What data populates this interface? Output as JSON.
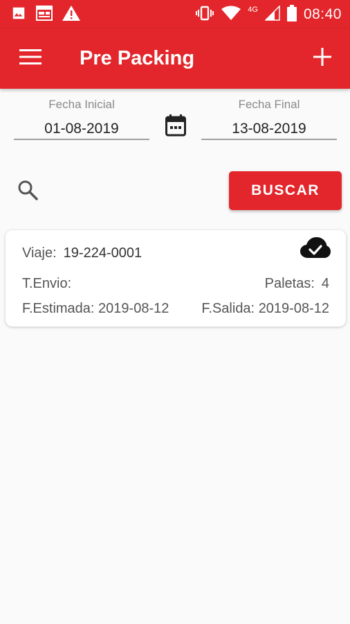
{
  "status_bar": {
    "time": "08:40",
    "network": "4G",
    "icons": [
      "image-icon",
      "calendar-icon",
      "warning-icon",
      "vibrate-icon",
      "wifi-icon",
      "signal-icon",
      "battery-icon"
    ]
  },
  "app_bar": {
    "title": "Pre Packing",
    "menu_icon": "hamburger-menu-icon",
    "add_icon": "plus-icon"
  },
  "filters": {
    "fecha_inicial": {
      "label": "Fecha Inicial",
      "value": "01-08-2019"
    },
    "fecha_final": {
      "label": "Fecha Final",
      "value": "13-08-2019"
    },
    "calendar_icon": "calendar-icon",
    "search_icon": "search-icon",
    "buscar_label": "BUSCAR"
  },
  "trips": [
    {
      "viaje_label": "Viaje:",
      "viaje_value": "19-224-0001",
      "sync_icon": "cloud-done-icon",
      "tenvio_label": "T.Envio:",
      "tenvio_value": "",
      "paletas_label": "Paletas:",
      "paletas_value": "4",
      "festimada_label": "F.Estimada:",
      "festimada_value": "2019-08-12",
      "salida_label": "F.Salida:",
      "salida_value": "2019-08-12"
    }
  ],
  "colors": {
    "primary": "#e3262b",
    "background": "#fafafa",
    "card": "#ffffff",
    "muted_text": "#8a8a8a"
  }
}
